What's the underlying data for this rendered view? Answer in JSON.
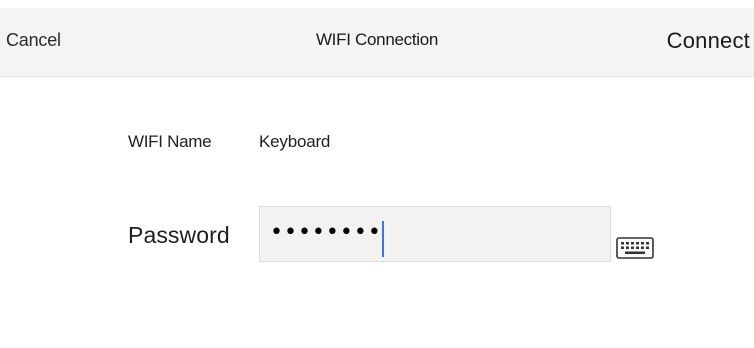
{
  "header": {
    "cancel_label": "Cancel",
    "title": "WIFI Connection",
    "connect_label": "Connect"
  },
  "form": {
    "name_label": "WIFI Name",
    "name_value": "Keyboard",
    "password_label": "Password",
    "password_masked": "••••••••",
    "password_length": 8
  },
  "icons": {
    "keyboard": "keyboard-icon"
  },
  "colors": {
    "header_bg": "#f4f4f4",
    "field_bg": "#f2f2f2",
    "caret": "#3b78d8"
  }
}
